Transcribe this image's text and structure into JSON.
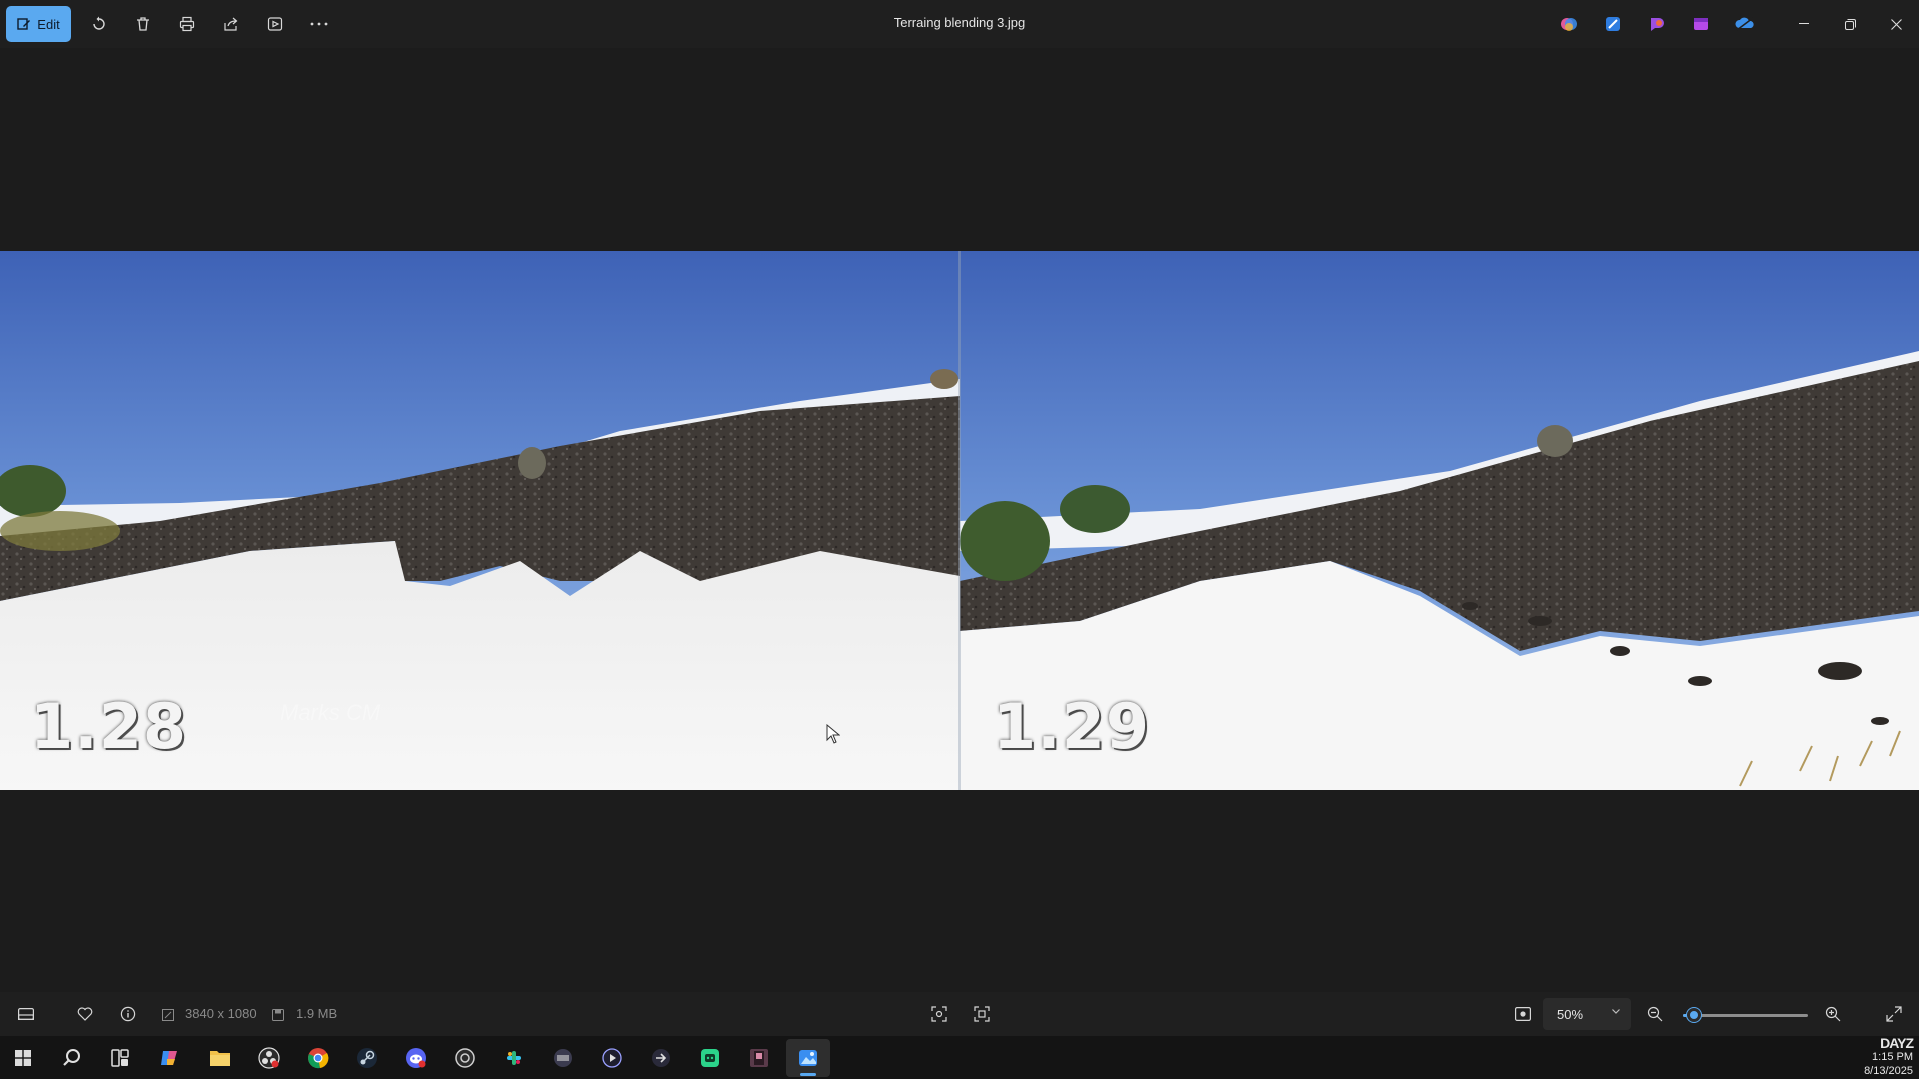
{
  "titlebar": {
    "edit_label": "Edit",
    "title": "Terraing blending 3.jpg",
    "apps": [
      "copilot-icon",
      "designer-icon",
      "clipchamp-icon",
      "video-editor-icon",
      "onedrive-icon"
    ]
  },
  "image": {
    "left_label": "1.28",
    "right_label": "1.29",
    "watermark": "Marks CM"
  },
  "statusbar": {
    "dimensions": "3840 x 1080",
    "filesize": "1.9 MB",
    "zoom": "50%",
    "zoom_level": 0.05
  },
  "taskbar": {
    "apps": [
      "windows-start-icon",
      "search-icon",
      "task-view-icon",
      "copilot-icon",
      "file-explorer-icon",
      "obs-icon",
      "chrome-icon",
      "steam-icon",
      "discord-icon",
      "app-icon",
      "slack-icon",
      "app-icon",
      "media-icon",
      "app-icon",
      "app-icon",
      "app-icon",
      "photos-icon"
    ]
  },
  "tray": {
    "brand": "DAYZ",
    "time": "1:15 PM",
    "date": "8/13/2025"
  },
  "colors": {
    "accent": "#5aa9f0",
    "background": "#1c1c1c",
    "sky_top": "#3f63b8",
    "sky_bottom": "#8cb2e4"
  }
}
